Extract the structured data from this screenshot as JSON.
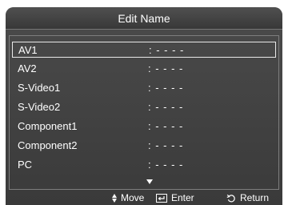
{
  "window": {
    "title": "Edit Name"
  },
  "items": [
    {
      "label": "AV1",
      "value": ": - - - -",
      "selected": true
    },
    {
      "label": "AV2",
      "value": ": - - - -"
    },
    {
      "label": "S-Video1",
      "value": ": - - - -"
    },
    {
      "label": "S-Video2",
      "value": ": - - - -"
    },
    {
      "label": "Component1",
      "value": ": - - - -"
    },
    {
      "label": "Component2",
      "value": ": - - - -"
    },
    {
      "label": "PC",
      "value": ": - - - -"
    }
  ],
  "footer": {
    "move_label": "Move",
    "enter_label": "Enter",
    "return_label": "Return"
  },
  "icons": {
    "move": "up-down-arrow-icon",
    "enter": "enter-icon",
    "return": "return-icon",
    "scroll": "scroll-down-arrow-icon"
  },
  "colors": {
    "background": "#424242",
    "text": "#ffffff",
    "selection_border": "#e8e8e8"
  }
}
